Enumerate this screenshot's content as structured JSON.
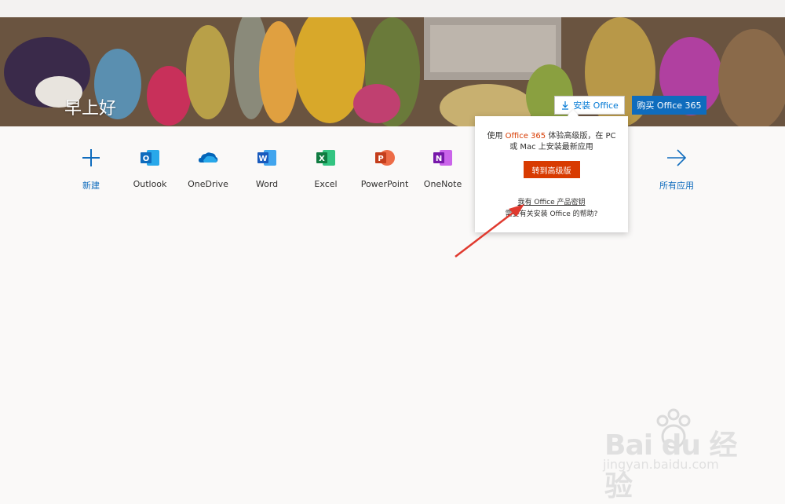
{
  "hero": {
    "greeting": "早上好",
    "install_label": "安装 Office",
    "buy_label": "购买 Office 365"
  },
  "apps": [
    {
      "name": "new",
      "label": "新建",
      "color": "#0f6cbd"
    },
    {
      "name": "outlook",
      "label": "Outlook",
      "color": "#0f6cbd"
    },
    {
      "name": "onedrive",
      "label": "OneDrive",
      "color": "#0364b8"
    },
    {
      "name": "word",
      "label": "Word",
      "color": "#185abd"
    },
    {
      "name": "excel",
      "label": "Excel",
      "color": "#107c41"
    },
    {
      "name": "powerpoint",
      "label": "PowerPoint",
      "color": "#c43e1c"
    },
    {
      "name": "onenote",
      "label": "OneNote",
      "color": "#7719aa"
    },
    {
      "name": "all-apps",
      "label": "所有应用",
      "color": "#0f6cbd"
    }
  ],
  "popup": {
    "text_prefix": "使用 ",
    "text_highlight": "Office 365",
    "text_suffix": " 体验高级版，在 PC 或 Mac 上安装最新应用",
    "upgrade_label": "转到高级版",
    "product_key_link": "我有 Office 产品密钥",
    "help_link": "需要有关安装 Office 的帮助?"
  },
  "watermark": {
    "line1": "Bai du 经验",
    "line2": "jingyan.baidu.com"
  },
  "colors": {
    "accent_blue": "#0f6cbd",
    "accent_orange": "#d83b01",
    "annotation_red": "#e03a2f"
  }
}
